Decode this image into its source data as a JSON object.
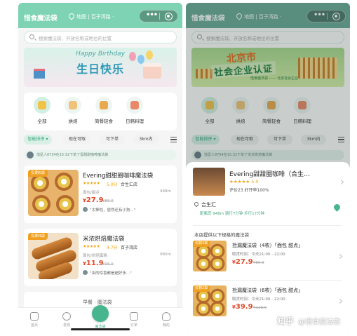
{
  "left": {
    "header": {
      "title": "惜食魔法袋",
      "location": "地图 | 百子湾路 ·",
      "more": "•••"
    },
    "search": {
      "placeholder": "搜索魔法袋、开放名称或地位的位置"
    },
    "banner": {
      "small": "Happy Birthday",
      "main": "生日快乐"
    },
    "categories": [
      {
        "label": "全部",
        "icon": "bag-icon",
        "color": "#f2c24b"
      },
      {
        "label": "烘焙",
        "icon": "cupcake-icon",
        "color": "#f0c27a"
      },
      {
        "label": "简餐轻食",
        "icon": "bowl-icon",
        "color": "#e8a94f"
      },
      {
        "label": "日韩料理",
        "icon": "sushi-icon",
        "color": "#e88a6a"
      }
    ],
    "filters": [
      "智能排序 ▾",
      "现在可取",
      "可下单",
      "3km内"
    ],
    "notice": "惜星人8734在15:32下单了蛋甜甜咖啡魔法袋",
    "shops": [
      {
        "tag": "仅剩5袋",
        "name": "Evering甜甜圈咖啡魔法袋",
        "stars": "★★★★★",
        "rating": "5.0分",
        "area": "合生汇店",
        "category": "面包/甜点",
        "distance": "948m",
        "price_symbol": "¥",
        "price": "27.9",
        "old_price": "¥85.9",
        "review": "\"太棒啦，居然还有小狗...\""
      },
      {
        "tag": "仅剩4袋",
        "name": "米浓烘焙魔法袋",
        "stars": "★★★★★",
        "rating": "4.7分",
        "area": "百子湾店",
        "category": "面包/烘焙蛋糕",
        "distance": "980m",
        "price_symbol": "¥",
        "price": "11.9",
        "old_price": "¥35.9",
        "review": "\"店的惊喜都是超好多...\""
      }
    ],
    "third_shop_partial": "早餐 · 魔法袋",
    "tabbar": [
      "首页",
      "发现",
      "魔法袋",
      "订单",
      "我的"
    ]
  },
  "right": {
    "header": {
      "title": "惜食魔法袋",
      "location": "地图 | 百子湾路 ·",
      "more": "•••"
    },
    "search": {
      "placeholder": "搜索魔法袋、开放名称或地位的位置"
    },
    "banner": {
      "main": "北京市",
      "sub": "社会企业认证",
      "note": "惜食魔法袋 —— 北京社会企业"
    },
    "categories": [
      {
        "label": "全部",
        "icon": "bag-icon",
        "color": "#f2c24b"
      },
      {
        "label": "烘焙",
        "icon": "cupcake-icon",
        "color": "#f0c27a"
      },
      {
        "label": "简餐轻食",
        "icon": "bowl-icon",
        "color": "#e8a94f"
      },
      {
        "label": "日韩料理",
        "icon": "sushi-icon",
        "color": "#e88a6a"
      }
    ],
    "filters": [
      "智能排序 ▾",
      "现在可取",
      "可下单",
      "3km内"
    ],
    "notice": "惜星人8764在15:32下单了米浓烘焙魔法袋",
    "sheet": {
      "shop_name": "Evering甜甜圈咖啡（合生…",
      "stars": "★★★★★",
      "rating": "5.0",
      "stats": "评价23 好评率100%",
      "address": "合生汇",
      "transit": "距离您 948m  骑行7分钟  步行17分钟",
      "section": "本店提供以下规格的魔法袋",
      "bags": [
        {
          "tag": "仅剩3袋",
          "name": "捡漏魔法袋（4枚）「面包 甜点」",
          "time": "取货时间：今天21:00 - 22:00",
          "price_symbol": "¥",
          "price": "27.9",
          "old_price": "¥85.9"
        },
        {
          "tag": "仅剩2袋",
          "name": "捡漏魔法袋（6枚）「面包 甜点」",
          "time": "取货时间：今天21:00 - 22:00",
          "price_symbol": "¥",
          "price": "39.9",
          "old_price": "¥128.9"
        }
      ]
    },
    "watermark_site": "知乎",
    "watermark_user": "@惜食魔法袋"
  }
}
